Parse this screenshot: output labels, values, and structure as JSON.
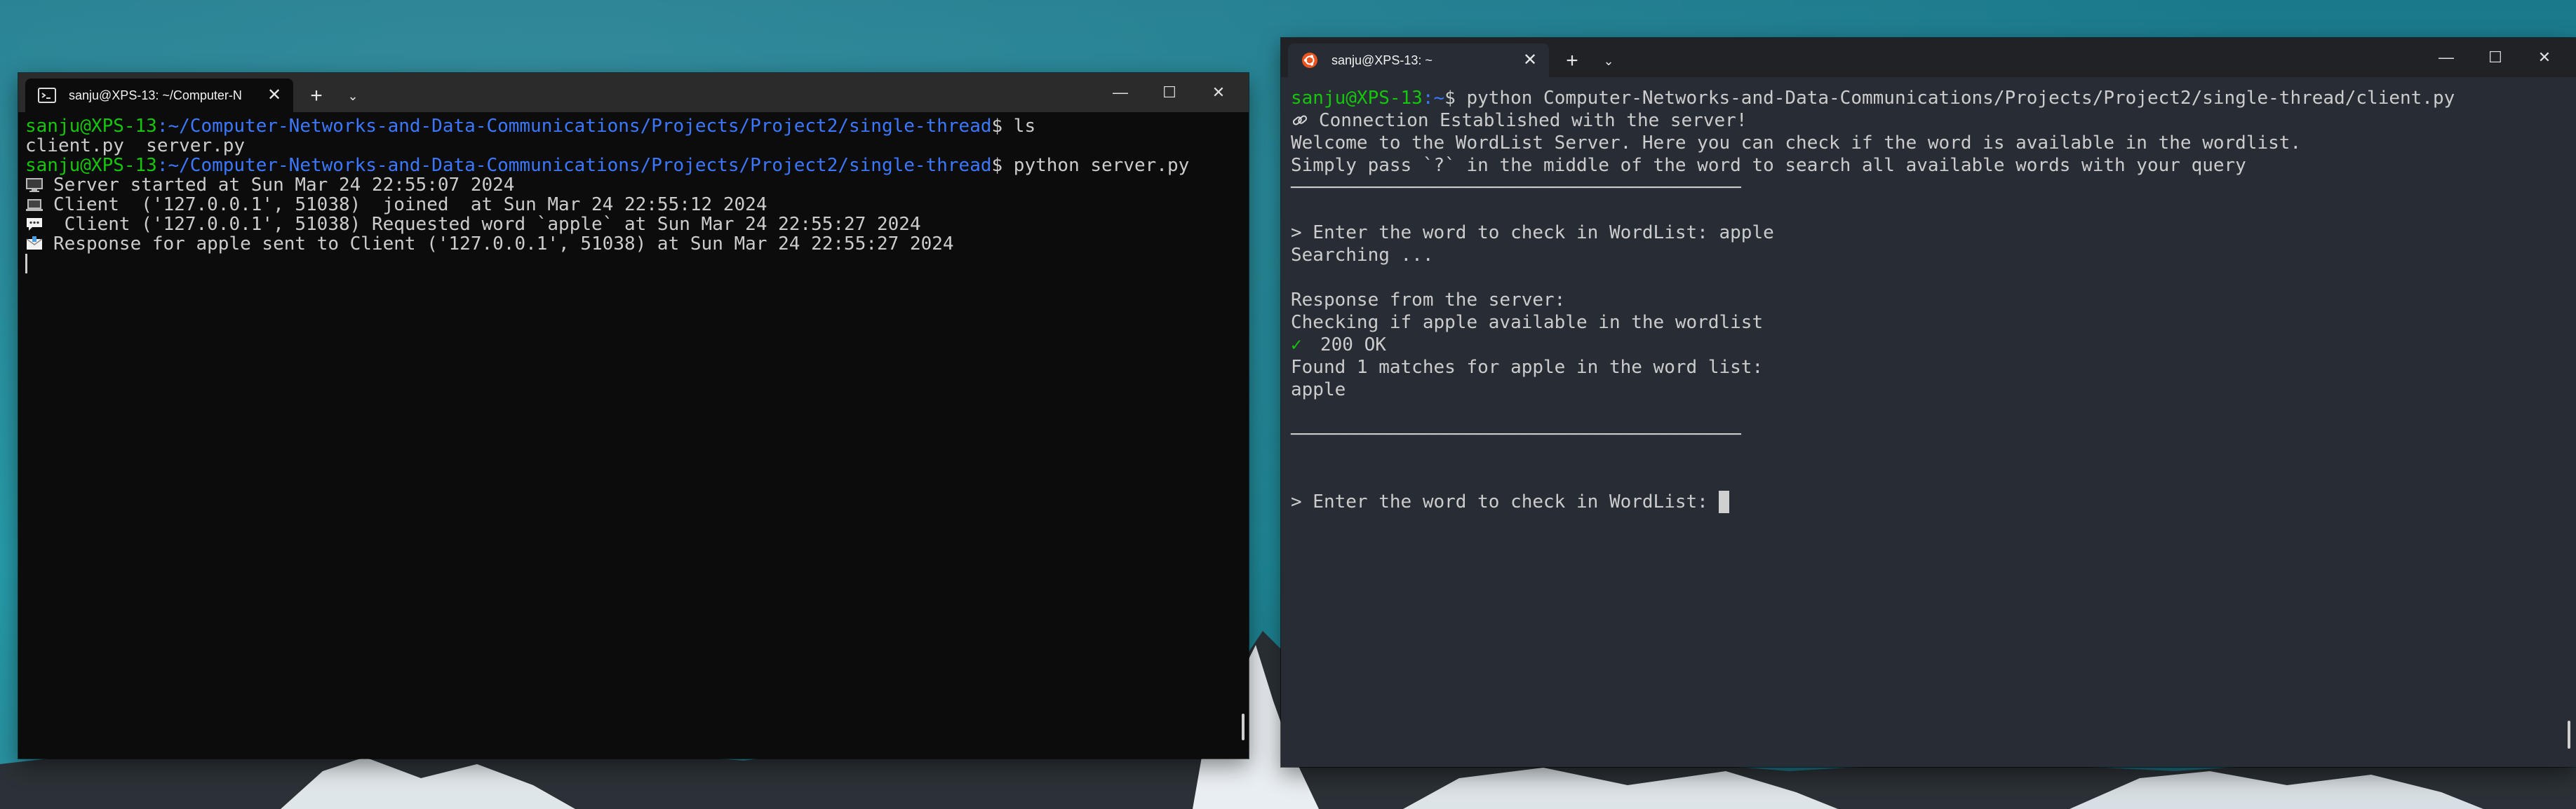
{
  "colors": {
    "prompt_user": "#16c60c",
    "prompt_path": "#3b78ff",
    "text": "#cccccc",
    "left_bg": "#0c0c0c",
    "right_bg": "#282c34"
  },
  "left_window": {
    "tab_title": "sanju@XPS-13: ~/Computer-N",
    "tab_icon": "terminal-icon",
    "buttons": {
      "new_tab": "+",
      "dropdown": "⌄",
      "minimize": "—",
      "maximize": "☐",
      "close": "✕"
    },
    "lines": [
      {
        "user": "sanju@XPS-13",
        "path": ":~/Computer-Networks-and-Data-Communications/Projects/Project2/single-thread",
        "cmd": "$ ls"
      },
      {
        "text": "client.py  server.py"
      },
      {
        "user": "sanju@XPS-13",
        "path": ":~/Computer-Networks-and-Data-Communications/Projects/Project2/single-thread",
        "cmd": "$ python server.py"
      },
      {
        "icon": "monitor-icon",
        "text": "Server started at Sun Mar 24 22:55:07 2024"
      },
      {
        "icon": "laptop-icon",
        "text": "Client  ('127.0.0.1', 51038)  joined  at Sun Mar 24 22:55:12 2024"
      },
      {
        "icon": "speech-bubble-icon",
        "text": " Client ('127.0.0.1', 51038) Requested word `apple` at Sun Mar 24 22:55:27 2024"
      },
      {
        "icon": "envelope-icon",
        "text": "Response for apple sent to Client ('127.0.0.1', 51038) at Sun Mar 24 22:55:27 2024"
      }
    ]
  },
  "right_window": {
    "tab_title": "sanju@XPS-13: ~",
    "tab_icon": "ubuntu-logo-icon",
    "buttons": {
      "new_tab": "+",
      "dropdown": "⌄",
      "minimize": "—",
      "maximize": "☐",
      "close": "✕"
    },
    "prompt": {
      "user": "sanju@XPS-13",
      "path": ":~",
      "cmd": "$ python Computer-Networks-and-Data-Communications/Projects/Project2/single-thread/client.py"
    },
    "connection": "Connection Established with the server!",
    "welcome_1": "Welcome to the WordList Server. Here you can check if the word is available in the wordlist.",
    "welcome_2": "Simply pass `?` in the middle of the word to search all available words with your query",
    "separator": "─────────────────────────────────────────",
    "query_1": "> Enter the word to check in WordList: apple",
    "searching": "Searching ...",
    "response_header": "Response from the server:",
    "checking": "Checking if apple available in the wordlist",
    "status": "200 OK",
    "found": "Found 1 matches for apple in the word list:",
    "result": "apple",
    "query_2": "> Enter the word to check in WordList: "
  }
}
